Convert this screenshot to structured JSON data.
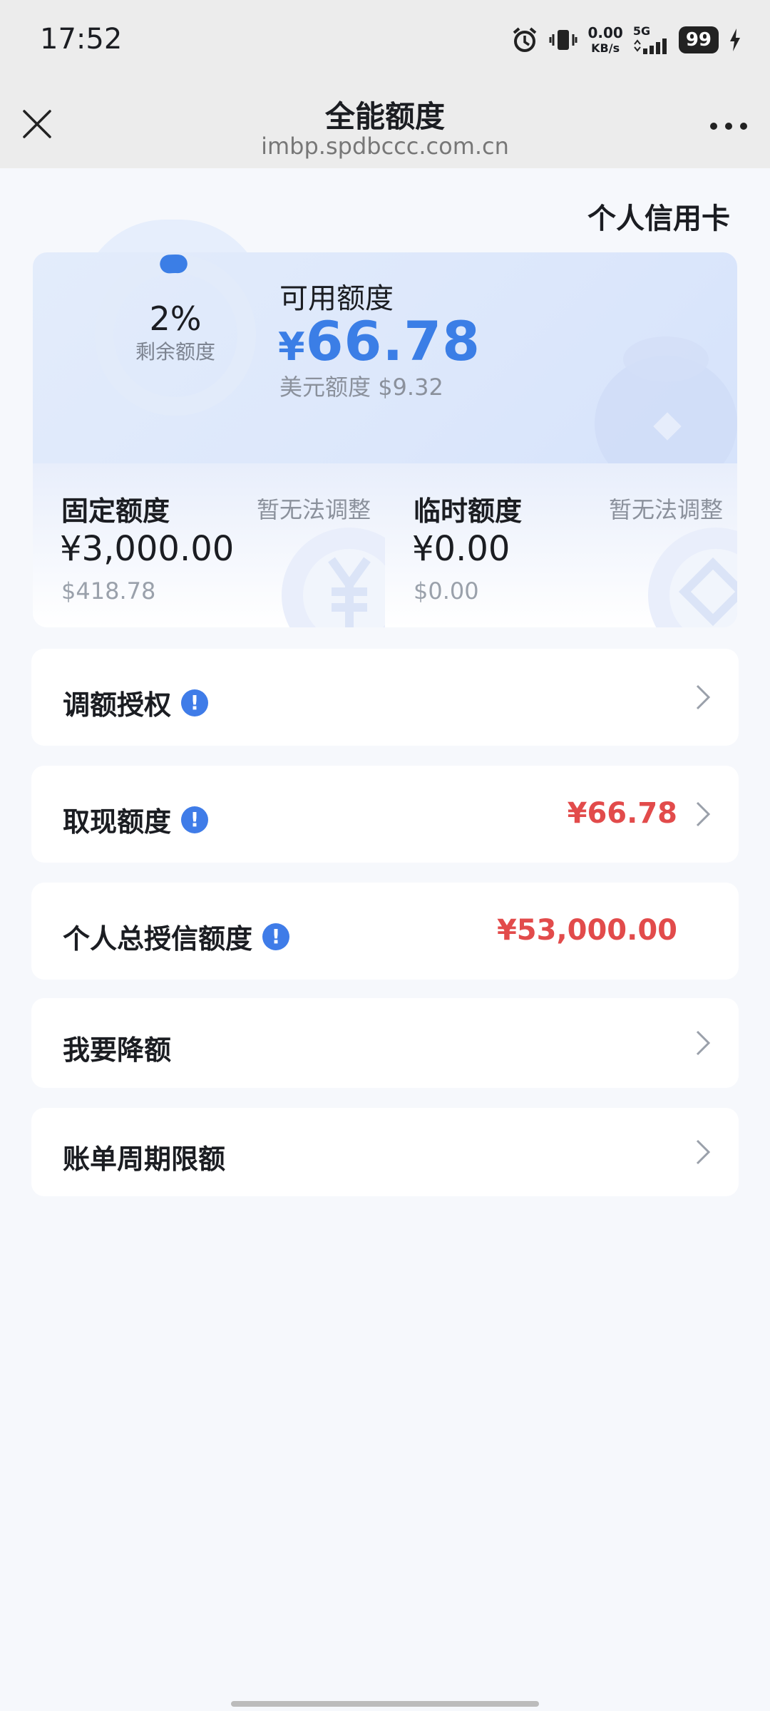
{
  "status_bar": {
    "time": "17:52",
    "net_speed_value": "0.00",
    "net_speed_unit": "KB/s",
    "network": "5G",
    "battery": "99"
  },
  "nav": {
    "title": "全能额度",
    "domain": "imbp.spdbccc.com.cn"
  },
  "card_type": "个人信用卡",
  "summary": {
    "remaining_percent": "2%",
    "remaining_fraction": 0.02,
    "remaining_label": "剩余额度",
    "available_label": "可用额度",
    "available_currency": "¥",
    "available_amount": "66.78",
    "usd_label": "美元额度",
    "usd_amount": "$9.32"
  },
  "fixed": {
    "label": "固定额度",
    "note": "暂无法调整",
    "amount": "¥3,000.00",
    "usd": "$418.78"
  },
  "temporary": {
    "label": "临时额度",
    "note": "暂无法调整",
    "amount": "¥0.00",
    "usd": "$0.00"
  },
  "rows": [
    {
      "label": "调额授权",
      "info": "!",
      "value": ""
    },
    {
      "label": "取现额度",
      "info": "!",
      "value": "¥66.78"
    },
    {
      "label": "个人总授信额度",
      "info": "!",
      "value": "¥53,000.00"
    },
    {
      "label": "我要降额",
      "value": ""
    },
    {
      "label": "账单周期限额",
      "value": ""
    }
  ],
  "colors": {
    "accent": "#3b7ee6",
    "value_red": "#e24b4b",
    "background": "#f6f8fc"
  }
}
